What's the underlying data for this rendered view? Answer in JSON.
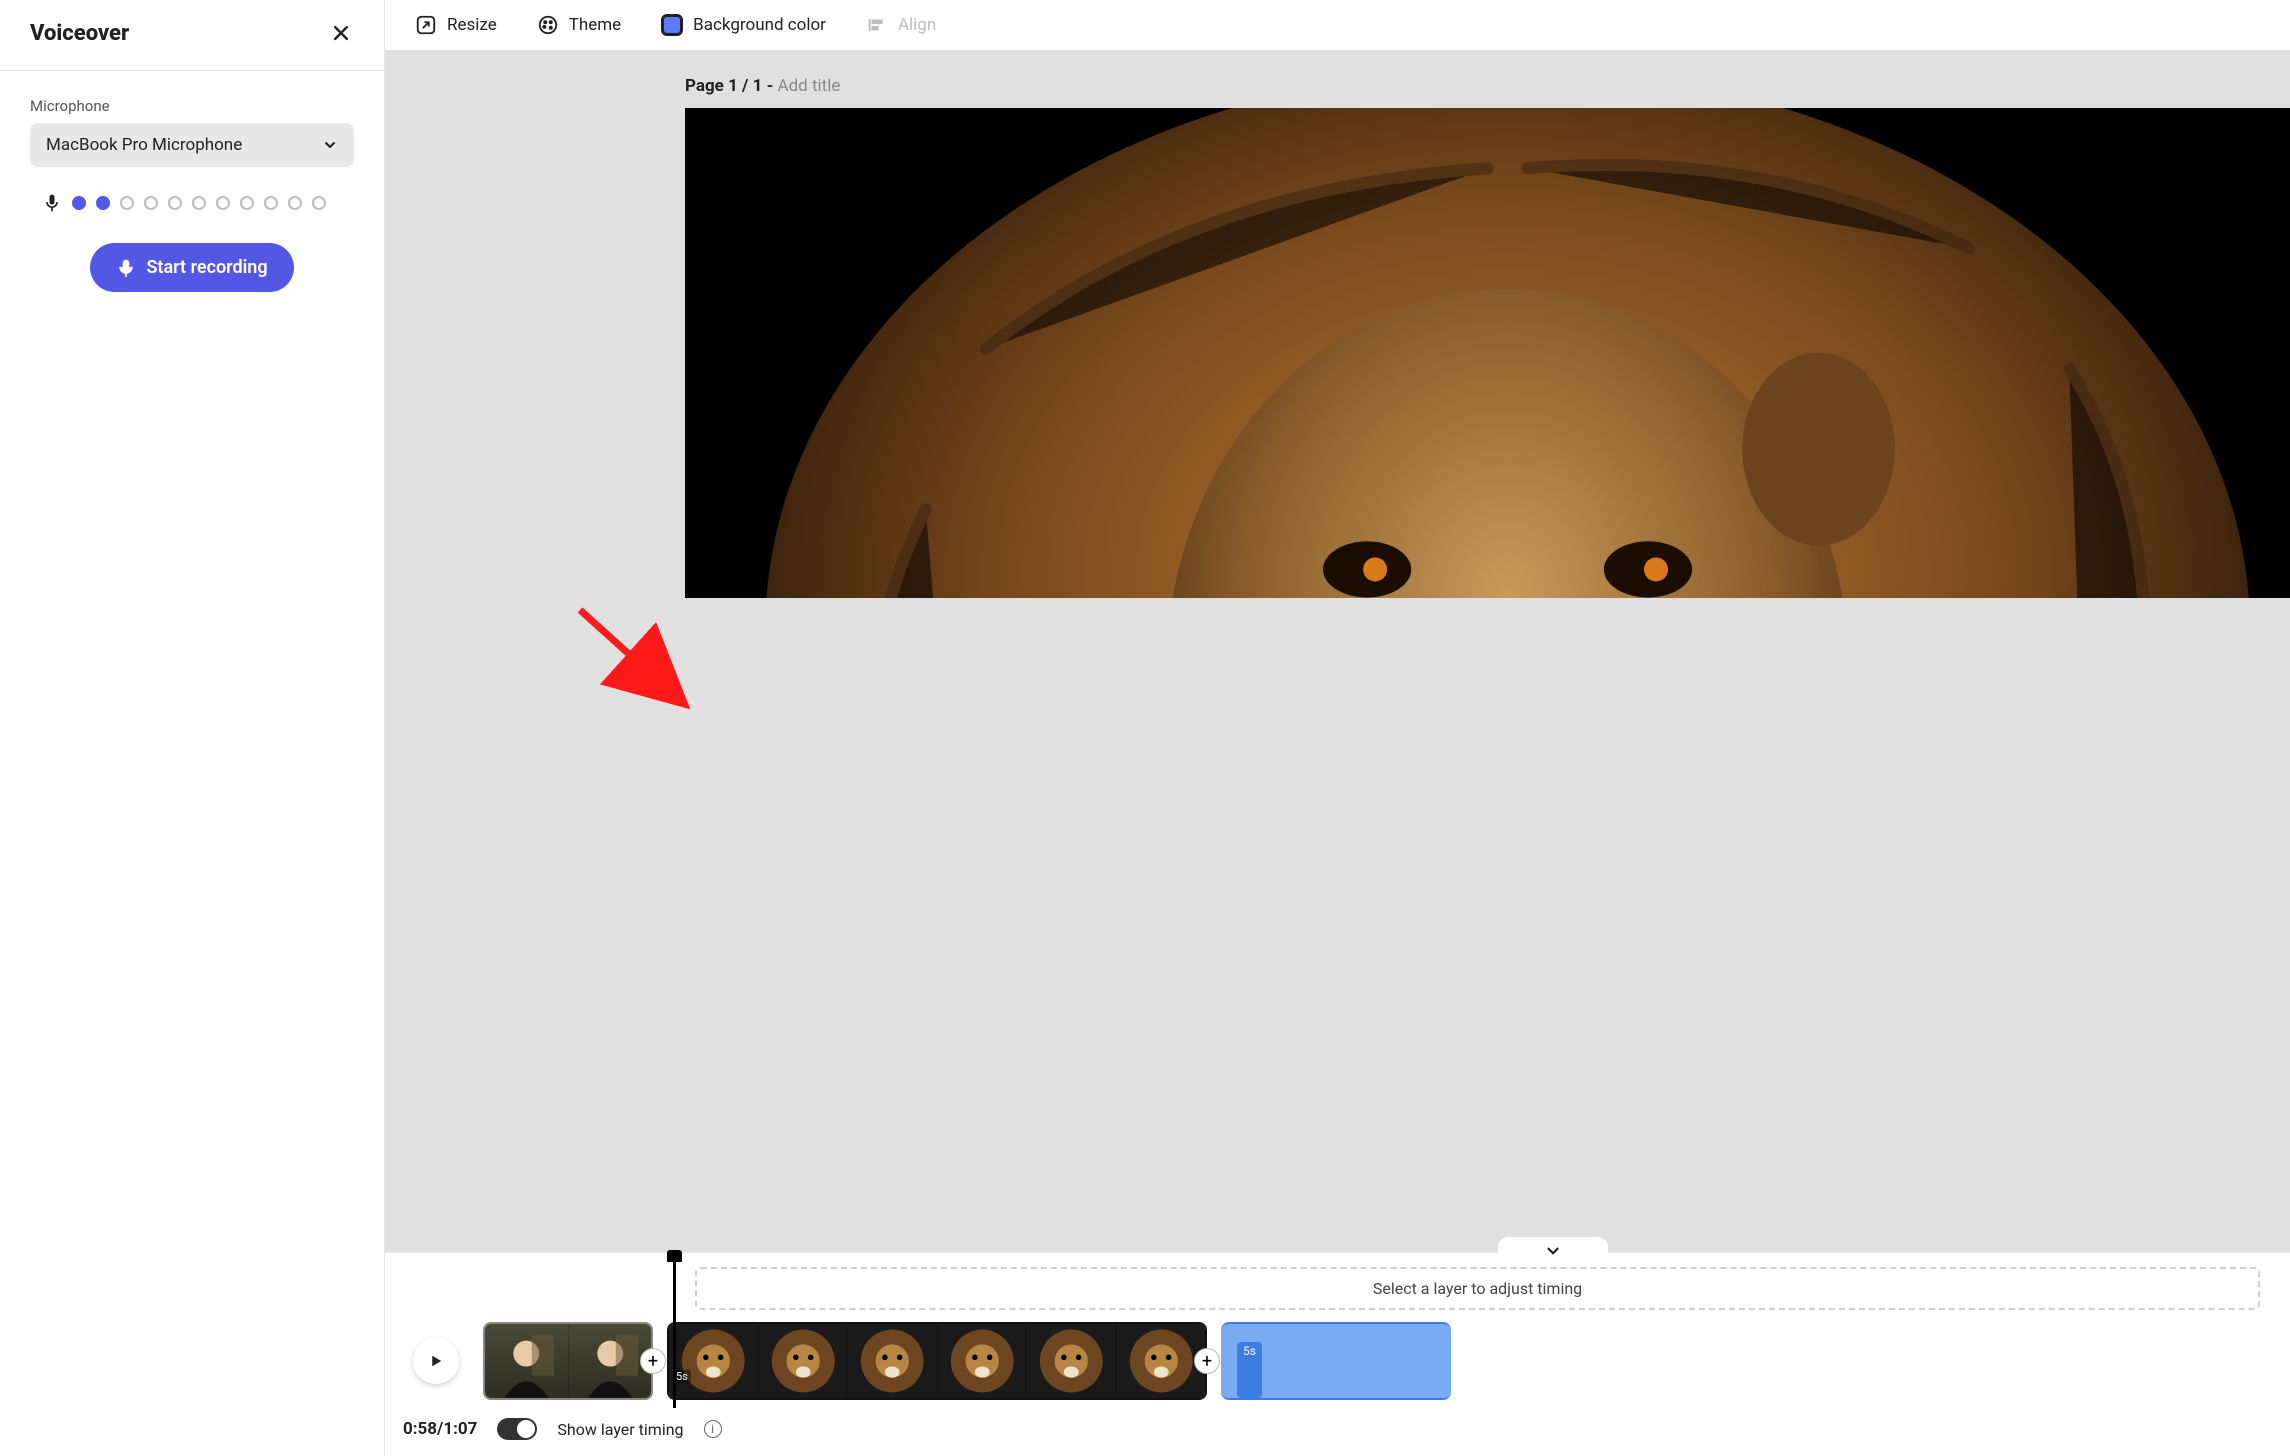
{
  "panel": {
    "title": "Voiceover",
    "mic_label": "Microphone",
    "mic_selected": "MacBook Pro Microphone",
    "record_label": "Start recording",
    "level": {
      "filled": 2,
      "total": 11
    }
  },
  "topbar": {
    "resize": "Resize",
    "theme": "Theme",
    "bgcolor": "Background color",
    "align": "Align",
    "swatch_hex": "#5a7bff"
  },
  "stage": {
    "page_prefix": "Page 1 / 1 - ",
    "add_title": "Add title"
  },
  "timeline": {
    "hint": "Select a layer to adjust timing",
    "clip2_tag": "5s",
    "clip3_badge": "5s",
    "timecode": "0:58/1:07",
    "layer_timing_label": "Show layer timing"
  }
}
